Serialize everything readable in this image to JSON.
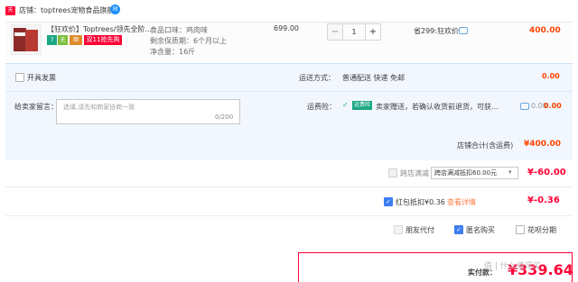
{
  "shop": {
    "badge": "天猫",
    "label": "店铺：",
    "name": "toptrees宠物食品旗舰",
    "chat_icon": "chat-bubble-icon"
  },
  "item": {
    "title": "【狂欢价】Toptrees/领先全阶...",
    "tags": [
      "7",
      "无",
      "顺",
      "双11抢先购"
    ],
    "attrs": {
      "flavor": "食品口味：鸡肉味",
      "shelf_life": "剩余保质期：6个月以上",
      "net_content": "净含量：16斤"
    },
    "unit_price": "699.00",
    "qty": "1",
    "qty_minus": "−",
    "qty_plus": "+",
    "promo": "省299:狂欢价",
    "subtotal": "400.00"
  },
  "extras": {
    "invoice_label": "开具发票",
    "shipping_label": "运送方式：",
    "shipping_value": "普通配送 快递 免邮",
    "shipping_amount": "0.00",
    "memo_label": "给卖家留言：",
    "memo_placeholder": "选填,请先和商家协商一致",
    "memo_count": "0/200",
    "insurance_label": "运费险：",
    "insurance_tag": "运费险",
    "insurance_text": "卖家赠送，若确认收货前退货，可获...",
    "insurance_amount": "0.00",
    "insurance_amount2": "0.00",
    "shop_total_label": "店铺合计(含运费)",
    "shop_total": "¥400.00"
  },
  "discounts": {
    "cross_shop_label": "跨店满减",
    "cross_shop_select": "跨店满减抵扣60.00元",
    "cross_shop_amount": "¥-60.00",
    "redpacket_label": "红包抵扣¥0.36",
    "redpacket_link": "查看详情",
    "redpacket_amount": "¥-0.36"
  },
  "options": {
    "friend_pay": "朋友代付",
    "anonymous": "匿名购买",
    "huabei": "花呗分期"
  },
  "payment": {
    "label": "实付款：",
    "amount": "¥339.64",
    "watermark": "值 | 什么值得买"
  },
  "colors": {
    "accent": "#ff0036",
    "amount": "#ff4400",
    "panel": "#f2f7ff",
    "check": "#3c7df0"
  }
}
